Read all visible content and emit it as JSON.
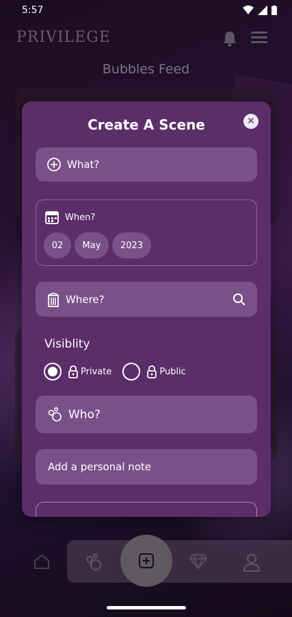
{
  "status_bar": {
    "time": "5:57"
  },
  "app": {
    "logo": "PRIVILEGE",
    "feed_title": "Bubbles Feed"
  },
  "modal": {
    "title": "Create A Scene",
    "what": {
      "placeholder": "What?"
    },
    "when": {
      "label": "When?",
      "day": "02",
      "month": "May",
      "year": "2023"
    },
    "where": {
      "placeholder": "Where?"
    },
    "visibility": {
      "title": "Visiblity",
      "options": [
        {
          "label": "Private",
          "selected": true
        },
        {
          "label": "Public",
          "selected": false
        }
      ]
    },
    "who": {
      "placeholder": "Who?"
    },
    "note": {
      "placeholder": "Add a personal note"
    }
  },
  "nav": {
    "items": [
      "home-icon",
      "bubbles-icon",
      "add-icon",
      "diamond-icon",
      "profile-icon"
    ]
  }
}
